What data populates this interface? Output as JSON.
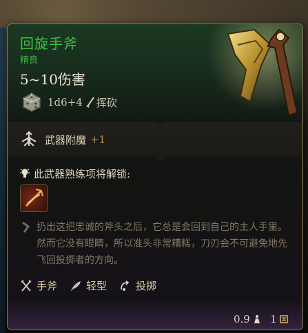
{
  "item": {
    "name": "回旋手斧",
    "rarity": "精良",
    "damage": "5~10伤害",
    "dice": "1d6+4",
    "damage_type": "挥砍",
    "name_color": "#39c23f"
  },
  "enchant": {
    "label": "武器附魔",
    "bonus": "+1"
  },
  "proficiency": {
    "label": "此武器熟练项将解锁:"
  },
  "description": "扔出这把忠诚的斧头之后，它总是会回到自己的主人手里。然而它没有眼睛，所以准头非常糟糕，刀刃会不可避免地先飞回投掷者的方向。",
  "properties": [
    {
      "label": "手斧",
      "icon": "crossed-axes-icon"
    },
    {
      "label": "轻型",
      "icon": "feather-icon"
    },
    {
      "label": "投掷",
      "icon": "throw-icon"
    }
  ],
  "footer": {
    "weight": "0.9",
    "price": "1"
  }
}
